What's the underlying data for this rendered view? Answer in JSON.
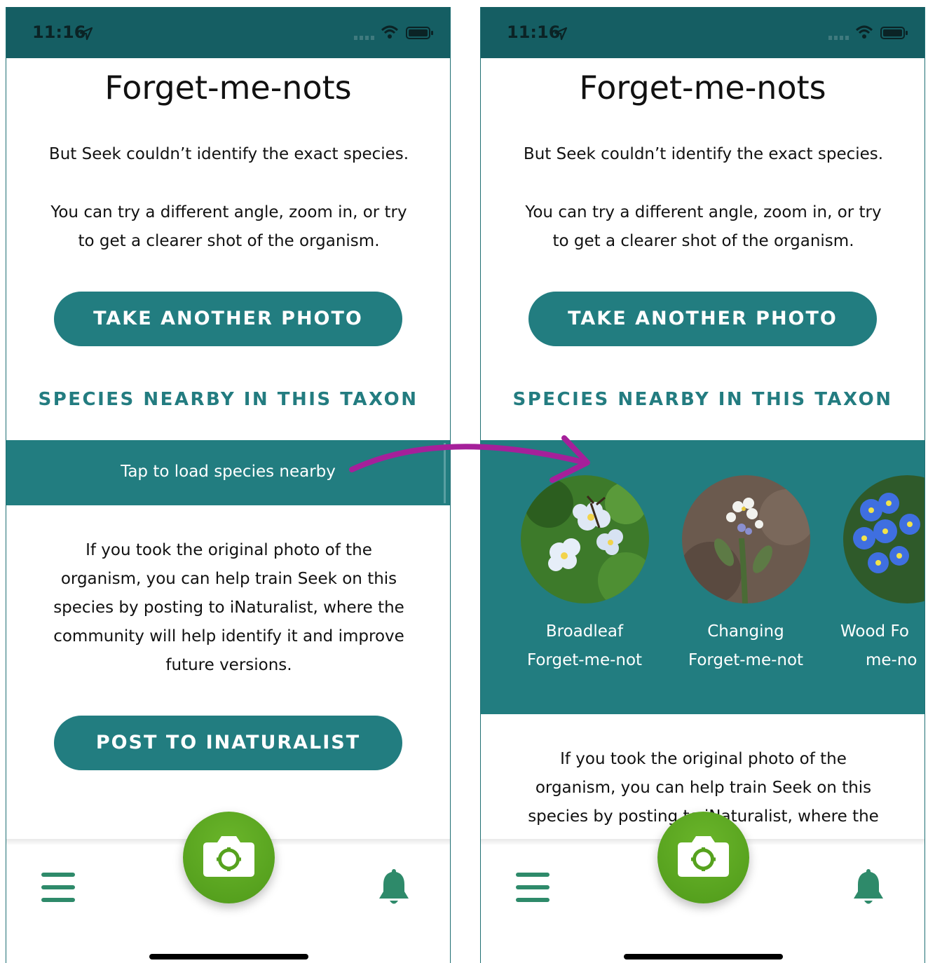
{
  "status_bar": {
    "time": "11:16"
  },
  "screen": {
    "title": "Forget-me-nots",
    "subtitle": "But Seek couldn’t identify the exact species.",
    "hint_line1": "You can try a different angle, zoom in, or try",
    "hint_line2": "to get a clearer shot of the organism.",
    "take_photo_button": "TAKE ANOTHER PHOTO",
    "species_heading": "SPECIES NEARBY IN THIS TAXON",
    "load_nearby": "Tap to load species nearby",
    "train_lines": [
      "If you took the original photo of the",
      "organism, you can help train Seek on this",
      "species by posting to iNaturalist, where the",
      "community will help identify it and improve",
      "future versions."
    ],
    "post_button": "POST TO INATURALIST"
  },
  "species": [
    {
      "line1": "Broadleaf",
      "line2": "Forget-me-not"
    },
    {
      "line1": "Changing",
      "line2": "Forget-me-not"
    },
    {
      "line1": "Wood Fo",
      "line2": "me-no"
    }
  ],
  "tab_bar": {
    "menu_icon": "menu-icon",
    "camera_icon": "camera-icon",
    "notifications_icon": "bell-icon"
  },
  "colors": {
    "teal": "#227d80",
    "status_teal": "#155e63",
    "green": "#5aa620",
    "arrow": "#a5209a",
    "nav_green": "#2e8a6a"
  }
}
